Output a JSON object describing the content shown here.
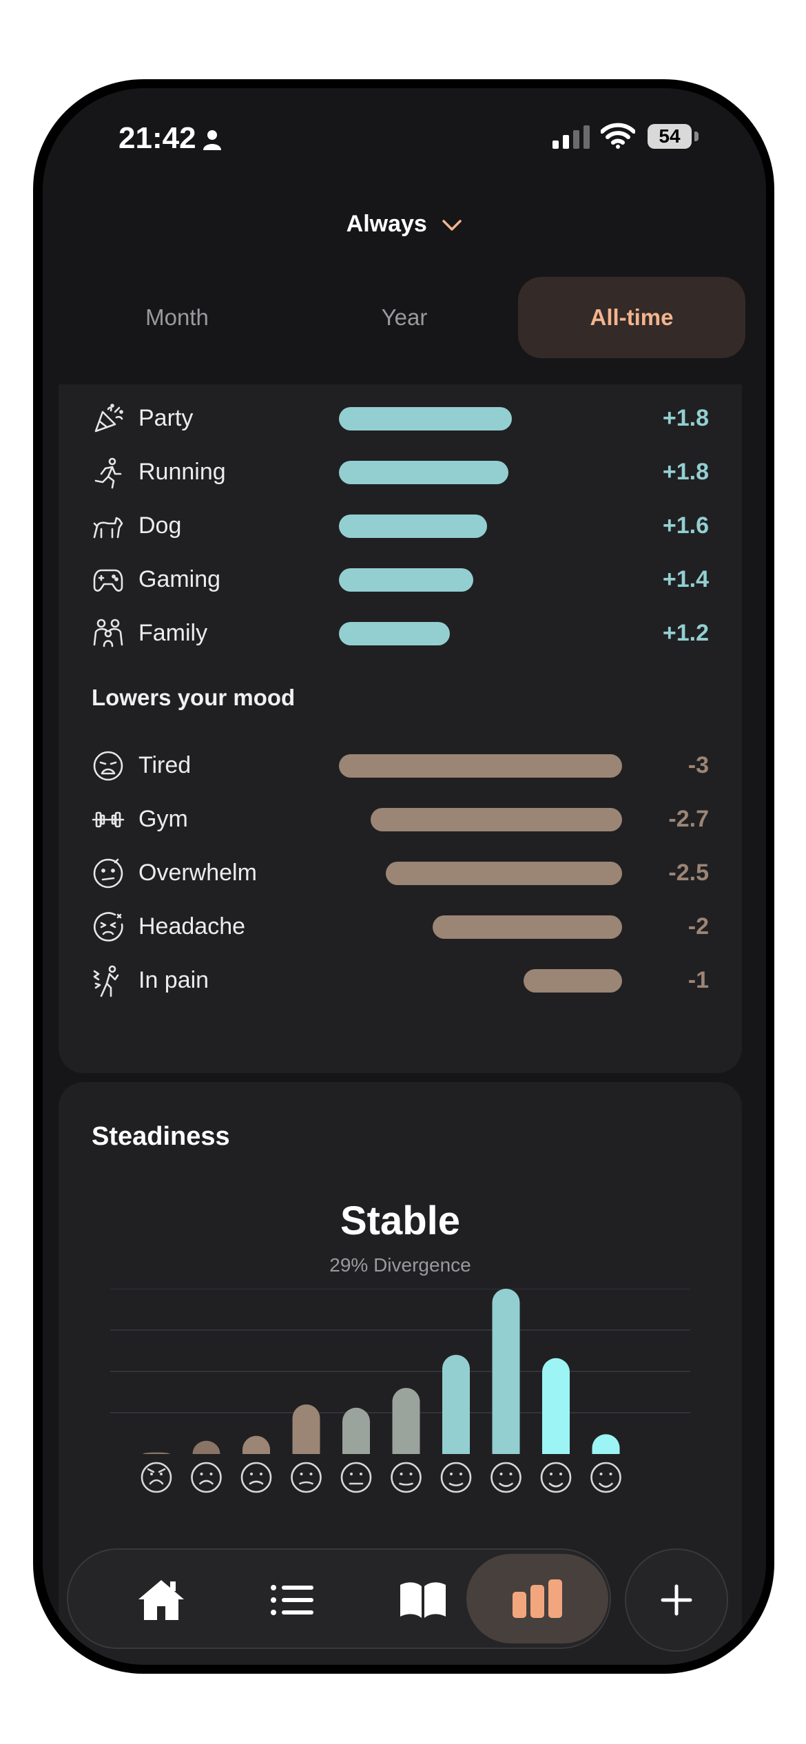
{
  "status": {
    "time": "21:42",
    "battery": "54"
  },
  "range_selector": {
    "label": "Always"
  },
  "tabs": [
    {
      "label": "Month",
      "active": false
    },
    {
      "label": "Year",
      "active": false
    },
    {
      "label": "All-time",
      "active": true
    }
  ],
  "raises": [
    {
      "label": "Party",
      "value": "+1.8",
      "icon": "party-popper-icon"
    },
    {
      "label": "Running",
      "value": "+1.8",
      "icon": "running-person-icon"
    },
    {
      "label": "Dog",
      "value": "+1.6",
      "icon": "dog-icon"
    },
    {
      "label": "Gaming",
      "value": "+1.4",
      "icon": "gamepad-icon"
    },
    {
      "label": "Family",
      "value": "+1.2",
      "icon": "family-icon"
    }
  ],
  "lowers": {
    "title": "Lowers your mood",
    "items": [
      {
        "label": "Tired",
        "value": "-3",
        "icon": "tired-face-icon"
      },
      {
        "label": "Gym",
        "value": "-2.7",
        "icon": "dumbbell-icon"
      },
      {
        "label": "Overwhelm",
        "value": "-2.5",
        "icon": "overwhelmed-face-icon"
      },
      {
        "label": "Headache",
        "value": "-2",
        "icon": "headache-face-icon"
      },
      {
        "label": "In pain",
        "value": "-1",
        "icon": "pain-figure-icon"
      }
    ]
  },
  "steadiness": {
    "title": "Steadiness",
    "status": "Stable",
    "divergence": "29% Divergence"
  },
  "chart_data": {
    "type": "bar",
    "categories": [
      "angry",
      "very sad",
      "sad",
      "down",
      "meh",
      "neutral",
      "slight smile",
      "smile",
      "happy",
      "very happy"
    ],
    "values": [
      0.01,
      0.08,
      0.11,
      0.3,
      0.28,
      0.4,
      0.6,
      1.0,
      0.58,
      0.12
    ],
    "colors": [
      "#8a7466",
      "#8a7466",
      "#9b8575",
      "#9b8575",
      "#9aa39c",
      "#9aa39c",
      "#93cfd1",
      "#93cfd1",
      "#9df4f4",
      "#9df4f4"
    ],
    "grid": true
  },
  "nav": {
    "items": [
      "home-icon",
      "list-icon",
      "journal-book-icon",
      "stats-bars-icon"
    ],
    "active": "stats-bars-icon",
    "add": "plus-icon"
  },
  "colors": {
    "accent": "#f2b48f",
    "positive": "#93cfd1",
    "negative": "#9b8575",
    "background": "#161618",
    "card": "#202023"
  }
}
